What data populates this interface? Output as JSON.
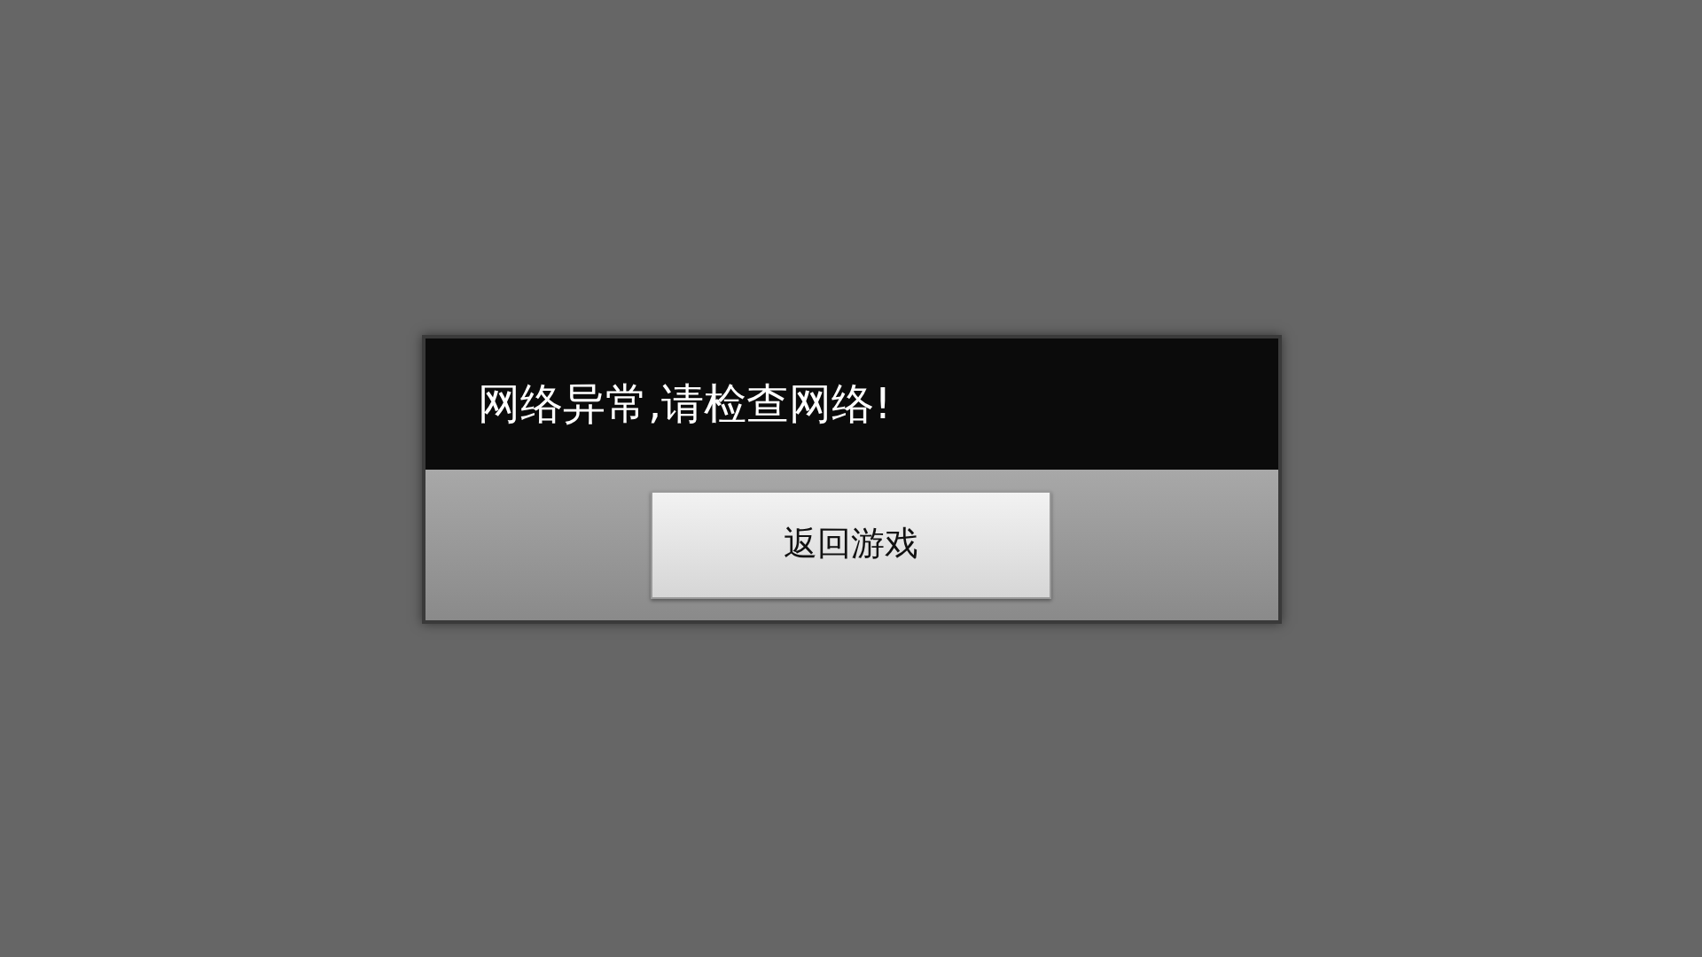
{
  "dialog": {
    "message": "网络异常,请检查网络!",
    "button": "返回游戏"
  }
}
